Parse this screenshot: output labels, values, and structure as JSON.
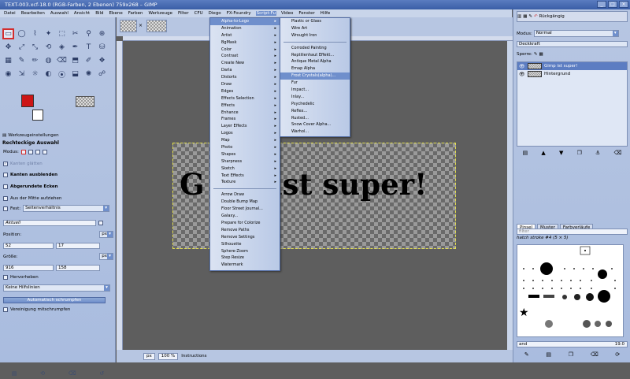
{
  "window": {
    "title": "TEXT-003.xcf-18.0 (RGB-Farben, 2 Ebenen) 759x268 – GIMP",
    "minimize": "_",
    "maximize": "□",
    "close": "×"
  },
  "menubar": {
    "items": [
      "Datei",
      "Bearbeiten",
      "Auswahl",
      "Ansicht",
      "Bild",
      "Ebene",
      "Farben",
      "Werkzeuge",
      "Filter",
      "CFU",
      "Diego",
      "FX-Foundry",
      "Script-Fu",
      "Video",
      "Fenster",
      "Hilfe"
    ],
    "active": "Script-Fu"
  },
  "script_fu_menu": {
    "items": [
      {
        "label": "Alpha-to-Logo",
        "has_sub": true,
        "highlighted": true
      },
      {
        "label": "Animation",
        "has_sub": true
      },
      {
        "label": "Artist",
        "has_sub": true
      },
      {
        "label": "BgMask",
        "has_sub": true
      },
      {
        "label": "Color",
        "has_sub": true
      },
      {
        "label": "Contrast",
        "has_sub": true
      },
      {
        "label": "Create New",
        "has_sub": true
      },
      {
        "label": "Darla",
        "has_sub": true
      },
      {
        "label": "Distorts",
        "has_sub": true
      },
      {
        "label": "Draw",
        "has_sub": true
      },
      {
        "label": "Edges",
        "has_sub": true
      },
      {
        "label": "Effects Selection",
        "has_sub": true
      },
      {
        "label": "Effects",
        "has_sub": true
      },
      {
        "label": "Enhance",
        "has_sub": true
      },
      {
        "label": "Frames",
        "has_sub": true
      },
      {
        "label": "Layer Effects",
        "has_sub": true
      },
      {
        "label": "Logos",
        "has_sub": true
      },
      {
        "label": "Map",
        "has_sub": true
      },
      {
        "label": "Photo",
        "has_sub": true
      },
      {
        "label": "Shapes",
        "has_sub": true
      },
      {
        "label": "Sharpness",
        "has_sub": true
      },
      {
        "label": "Sketch",
        "has_sub": true
      },
      {
        "label": "Text Effects",
        "has_sub": true
      },
      {
        "label": "Texture",
        "has_sub": true
      }
    ],
    "items_after_sep": [
      {
        "label": "Arrow Draw"
      },
      {
        "label": "Double Bump Map"
      },
      {
        "label": "Floor Street Journal..."
      },
      {
        "label": "Galaxy..."
      },
      {
        "label": "Prepare for Colorize"
      },
      {
        "label": "Remove Paths"
      },
      {
        "label": "Remove Settings"
      },
      {
        "label": "Silhouette"
      },
      {
        "label": "Sphere-Zoom"
      },
      {
        "label": "Step Resize"
      },
      {
        "label": "Watermark"
      }
    ]
  },
  "alpha_to_logo_menu": {
    "group1": [
      "Plastic or Glass",
      "Wire Art",
      "Wrought Iron"
    ],
    "group2": [
      "Corroded Painting",
      "Reptilienhaut Effekt...",
      "Antique Metal Alpha",
      "Emap Alpha"
    ],
    "highlighted": "Frost Crystals(alpha)...",
    "group3": [
      "Fur",
      "Impact...",
      "Inlay...",
      "Psychedelic",
      "Reflex...",
      "Rusted...",
      "Snow Cover Alpha...",
      "Warhol..."
    ]
  },
  "toolbox": {
    "tools": [
      "▭",
      "◯",
      "⌇",
      "✦",
      "⬚",
      "✂",
      "⚲",
      "⊕",
      "✥",
      "⤢",
      "⤡",
      "⟲",
      "◈",
      "✒",
      "T",
      "⛁",
      "▦",
      "✎",
      "✏",
      "◍",
      "⌫",
      "⬒",
      "✐",
      "❖",
      "◉",
      "⇲",
      "☼",
      "◐",
      "⦿",
      "⬓",
      "✺",
      "☍"
    ],
    "selected_index": 0,
    "options_tab_label": "Werkzeugeinstellungen",
    "tool_title": "Rechteckige Auswahl",
    "modus_label": "Modus:",
    "kanten_glaetten": "Kanten glätten",
    "kanten_ausblenden": "Kanten ausblenden",
    "abgerundete_ecken": "Abgerundete Ecken",
    "aus_der_mitte": "Aus der Mitte aufziehen",
    "fest_label": "Fest:",
    "fest_value": "Seitenverhältnis",
    "aktuell_value": "Aktuell",
    "position_label": "Position:",
    "position_unit": "px",
    "position_x": "52",
    "position_y": "17",
    "groesse_label": "Größe:",
    "groesse_unit": "px",
    "groesse_w": "916",
    "groesse_h": "158",
    "hervorheben": "Hervorheben",
    "hilfslinien_value": "Keine Hilfslinien",
    "auto_shrink_button": "Automatisch schrumpfen",
    "vereinigung": "Vereinigung mitschrumpfen"
  },
  "image": {
    "text": "Gimp ist super!",
    "visible_text_left": "G",
    "visible_text_right": "ist super!"
  },
  "status": {
    "unit": "px",
    "zoom": "100 %",
    "message": "Instructions"
  },
  "dock": {
    "modus_label": "Modus:",
    "modus_value": "Normal",
    "deckkraft_label": "Deckkraft",
    "sperre_label": "Sperre:",
    "undo_label": "Rückgängig",
    "layers": [
      {
        "name": "Gimp ist super!",
        "active": true
      },
      {
        "name": "Hintergrund",
        "active": false
      }
    ],
    "brush_tabs": [
      "Pinsel",
      "Muster",
      "Farbverläufe"
    ],
    "brush_filter_placeholder": "filter",
    "brush_name": "hatch stroke #4 (5 × 5)",
    "brush_bottom_label": "and",
    "brush_spacing": "19.0"
  },
  "colors": {
    "foreground": "#cc1515",
    "background": "#ffffff",
    "accent": "#6f8fcc"
  }
}
